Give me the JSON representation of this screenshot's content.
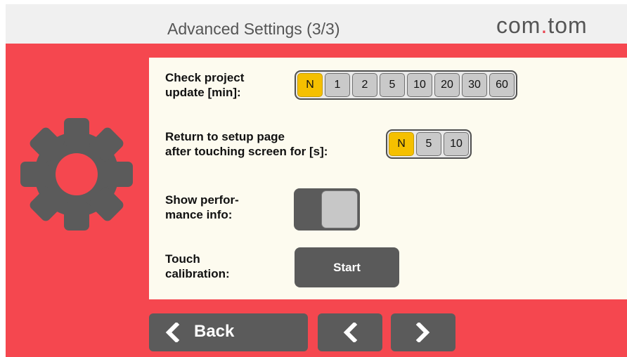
{
  "header": {
    "title": "Advanced Settings (3/3)"
  },
  "logo": {
    "part1": "com",
    "dot": ".",
    "part2": "tom"
  },
  "settings": {
    "project_update": {
      "label_line1": "Check project",
      "label_line2": "update [min]:",
      "options": [
        "N",
        "1",
        "2",
        "5",
        "10",
        "20",
        "30",
        "60"
      ],
      "selected": "N"
    },
    "return_setup": {
      "label_line1": "Return to setup page",
      "label_line2": "after touching screen for [s]:",
      "options": [
        "N",
        "5",
        "10"
      ],
      "selected": "N"
    },
    "performance": {
      "label_line1": "Show perfor-",
      "label_line2": "mance info:",
      "enabled": false
    },
    "touch_calibration": {
      "label_line1": "Touch",
      "label_line2": "calibration:",
      "button_label": "Start"
    }
  },
  "nav": {
    "back_label": "Back"
  },
  "icons": {
    "settings": "gear-icon",
    "back": "chevron-left-icon",
    "prev": "chevron-left-icon",
    "next": "chevron-right-icon"
  },
  "colors": {
    "accent": "#f5474f",
    "selected": "#f5c000",
    "button": "#5b5b5b",
    "panel": "#fdfbef"
  }
}
